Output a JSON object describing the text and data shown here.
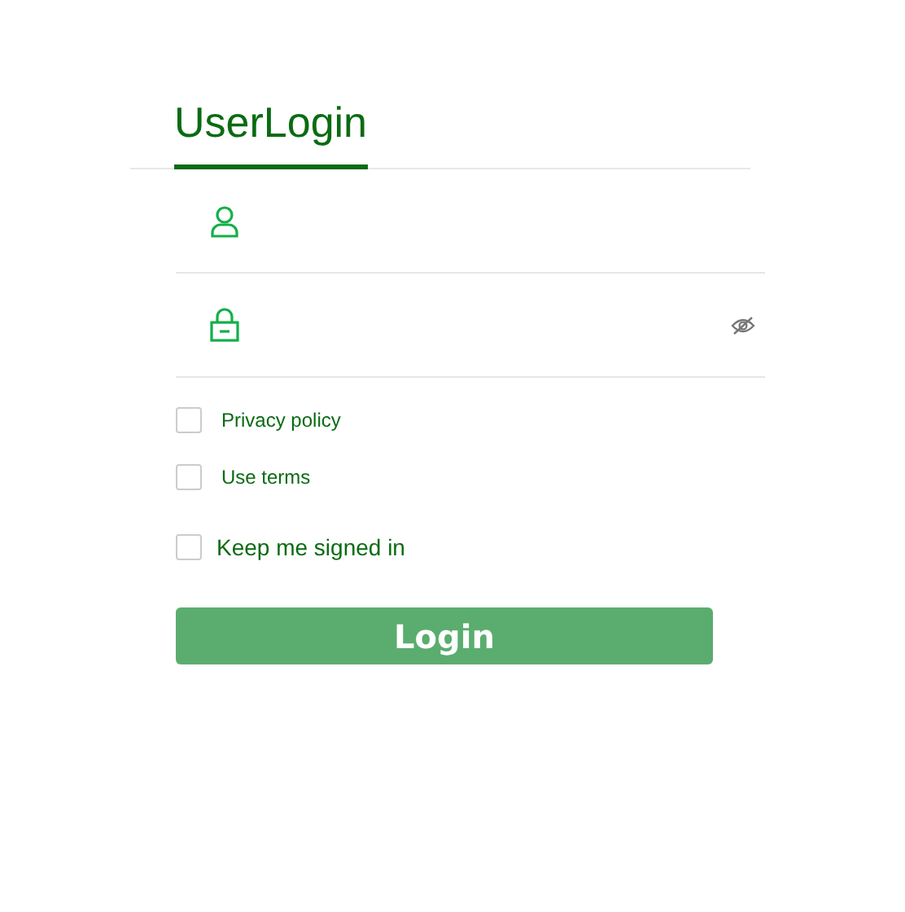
{
  "tabs": [
    {
      "label": "UserLogin",
      "selected": true
    }
  ],
  "fields": [
    {
      "kind": "user"
    },
    {
      "kind": "password",
      "password_hidden": true
    }
  ],
  "checkboxes": [
    {
      "label": "Privacy policy",
      "checked": false,
      "kind": "agreement"
    },
    {
      "label": "Use terms",
      "checked": false,
      "kind": "agreement"
    },
    {
      "label": "Keep me signed in",
      "checked": false,
      "kind": "remember"
    }
  ],
  "button": "Login"
}
